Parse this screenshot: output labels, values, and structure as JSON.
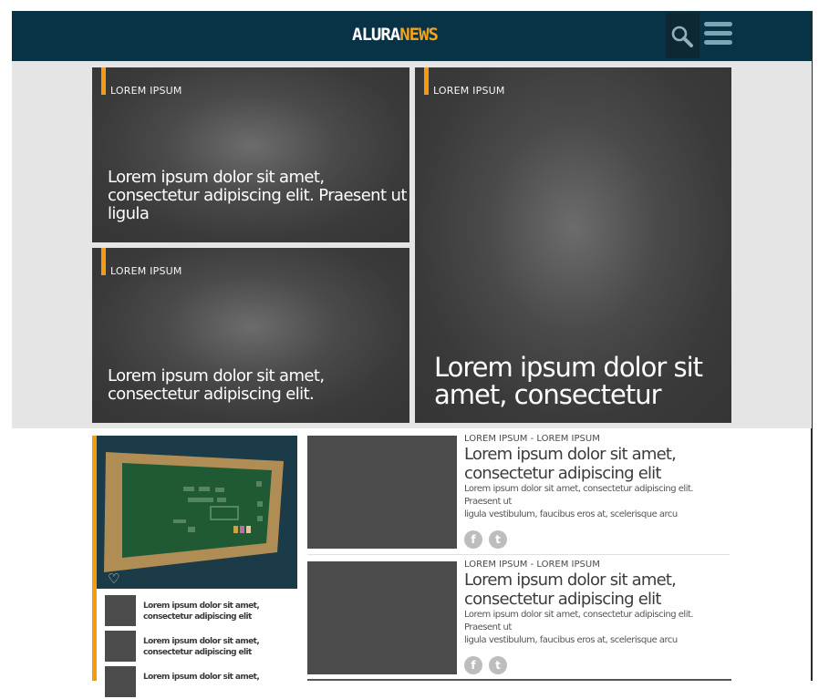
{
  "header": {
    "logo_part1": "ALURA",
    "logo_part2": "NEWS",
    "search_icon": "search-icon",
    "menu_icon": "hamburger-menu-icon",
    "colors": {
      "bar": "#083346",
      "accent": "#f3a21b"
    }
  },
  "hero": {
    "cards": [
      {
        "tag": "LOREM IPSUM",
        "title_lines": [
          "Lorem ipsum dolor sit amet,",
          "consectetur adipiscing elit. Praesent ut",
          "ligula"
        ]
      },
      {
        "tag": "LOREM IPSUM",
        "title_lines": [
          "Lorem ipsum dolor sit amet,",
          "consectetur adipiscing elit."
        ]
      },
      {
        "tag": "LOREM IPSUM",
        "title_lines": [
          "Lorem ipsum dolor sit",
          "amet, consectetur"
        ]
      }
    ]
  },
  "sidebar": {
    "heart_icon": "heart-icon",
    "items": [
      {
        "title_lines": [
          "Lorem ipsum dolor sit amet,",
          "consectetur adipiscing elit"
        ]
      },
      {
        "title_lines": [
          "Lorem ipsum dolor sit amet,",
          "consectetur adipiscing elit"
        ]
      },
      {
        "title_lines": [
          "Lorem ipsum dolor sit amet,",
          ""
        ]
      }
    ]
  },
  "articles": [
    {
      "meta": "LOREM IPSUM - LOREM IPSUM",
      "title_lines": [
        "Lorem ipsum dolor sit amet,",
        "consectetur adipiscing elit"
      ],
      "excerpt_lines": [
        "Lorem ipsum dolor sit amet, consectetur adipiscing elit. Praesent ut",
        "ligula vestibulum, faucibus eros at, scelerisque arcu"
      ],
      "share_facebook": "f",
      "share_twitter": "t"
    },
    {
      "meta": "LOREM IPSUM - LOREM IPSUM",
      "title_lines": [
        "Lorem ipsum dolor sit amet,",
        "consectetur adipiscing elit"
      ],
      "excerpt_lines": [
        "Lorem ipsum dolor sit amet, consectetur adipiscing elit. Praesent ut",
        "ligula vestibulum, faucibus eros at, scelerisque arcu"
      ],
      "share_facebook": "f",
      "share_twitter": "t"
    }
  ]
}
